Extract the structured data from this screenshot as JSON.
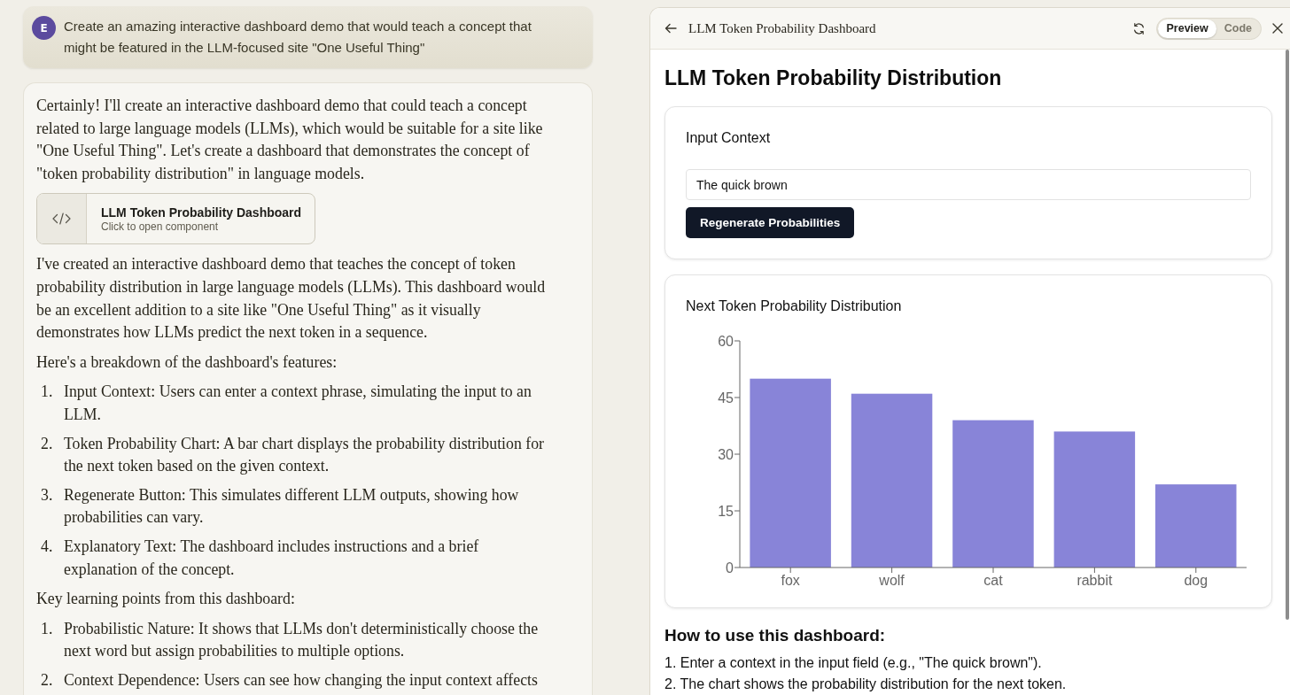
{
  "chat": {
    "user_message": {
      "avatar": "E",
      "text": "Create an amazing interactive dashboard demo that would teach a concept that might be featured in the LLM-focused site \"One Useful Thing\""
    },
    "reply": {
      "intro": "Certainly! I'll create an interactive dashboard demo that could teach a concept related to large language models (LLMs), which would be suitable for a site like \"One Useful Thing\". Let's create a dashboard that demonstrates the concept of \"token probability distribution\" in language models.",
      "artifact": {
        "title": "LLM Token Probability Dashboard",
        "subtitle": "Click to open component"
      },
      "summary": "I've created an interactive dashboard demo that teaches the concept of token probability distribution in large language models (LLMs). This dashboard would be an excellent addition to a site like \"One Useful Thing\" as it visually demonstrates how LLMs predict the next token in a sequence.",
      "features_intro": "Here's a breakdown of the dashboard's features:",
      "features": [
        {
          "number": "1.",
          "text": "Input Context: Users can enter a context phrase, simulating the input to an LLM."
        },
        {
          "number": "2.",
          "text": "Token Probability Chart: A bar chart displays the probability distribution for the next token based on the given context."
        },
        {
          "number": "3.",
          "text": "Regenerate Button: This simulates different LLM outputs, showing how probabilities can vary."
        },
        {
          "number": "4.",
          "text": "Explanatory Text: The dashboard includes instructions and a brief explanation of the concept."
        }
      ],
      "learning_intro": "Key learning points from this dashboard:",
      "learning_points": [
        {
          "number": "1.",
          "text": "Probabilistic Nature: It shows that LLMs don't deterministically choose the next word but assign probabilities to multiple options."
        },
        {
          "number": "2.",
          "text": "Context Dependence: Users can see how changing the input context affects"
        }
      ]
    }
  },
  "artifact_panel": {
    "title": "LLM Token Probability Dashboard",
    "view_toggle": [
      {
        "label": "Preview",
        "selected": true
      },
      {
        "label": "Code",
        "selected": false
      }
    ],
    "preview": {
      "heading": "LLM Token Probability Distribution",
      "input_card": {
        "label": "Input Context",
        "input_value": "The quick brown",
        "button": "Regenerate Probabilities"
      },
      "chart_card": {
        "title": "Next Token Probability Distribution",
        "chart_data": {
          "type": "bar",
          "categories": [
            "fox",
            "wolf",
            "cat",
            "rabbit",
            "dog"
          ],
          "values": [
            50,
            46,
            39,
            36,
            22
          ],
          "color": "#8884d8",
          "ylim": [
            0,
            60
          ],
          "yticks": [
            0,
            15,
            30,
            45,
            60
          ]
        }
      },
      "instructions": {
        "heading": "How to use this dashboard:",
        "steps": [
          "1. Enter a context in the input field (e.g., \"The quick brown\").",
          "2. The chart shows the probability distribution for the next token."
        ]
      }
    }
  }
}
